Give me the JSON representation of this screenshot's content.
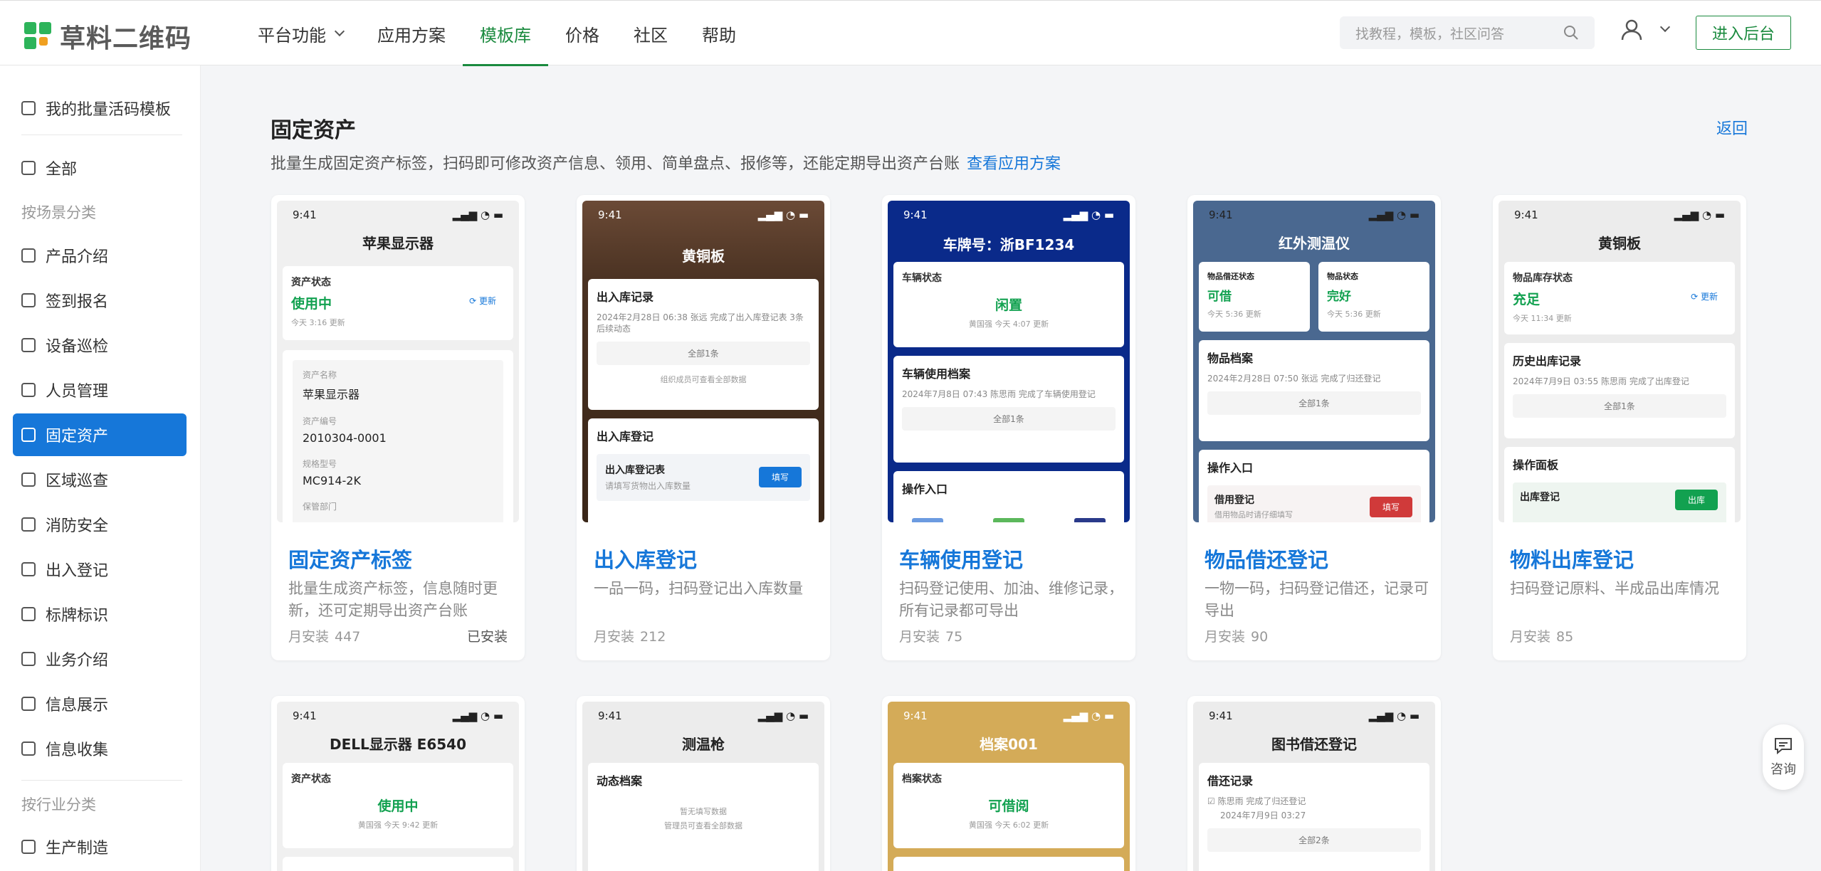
{
  "brand": {
    "name": "草料二维码",
    "colors": [
      "#2db45a",
      "#2db45a",
      "#2db45a",
      "#f0a020"
    ]
  },
  "nav": [
    {
      "label": "平台功能",
      "has_dropdown": true
    },
    {
      "label": "应用方案"
    },
    {
      "label": "模板库",
      "active": true
    },
    {
      "label": "价格"
    },
    {
      "label": "社区"
    },
    {
      "label": "帮助"
    }
  ],
  "search": {
    "placeholder": "找教程，模板，社区问答",
    "icon": "search-icon"
  },
  "user": {
    "icon": "user-icon"
  },
  "admin_button": "进入后台",
  "sidebar": {
    "my_templates": "我的批量活码模板",
    "all": "全部",
    "scene_head": "按场景分类",
    "scene_items": [
      "产品介绍",
      "签到报名",
      "设备巡检",
      "人员管理",
      "固定资产",
      "区域巡查",
      "消防安全",
      "出入登记",
      "标牌标识",
      "业务介绍",
      "信息展示",
      "信息收集"
    ],
    "active_item": "固定资产",
    "industry_head": "按行业分类",
    "industry_items": [
      "生产制造"
    ]
  },
  "page": {
    "title": "固定资产",
    "back": "返回",
    "description": "批量生成固定资产标签，扫码即可修改资产信息、领用、简单盘点、报修等，还能定期导出资产台账",
    "solution_link": "查看应用方案"
  },
  "cards": [
    {
      "name": "固定资产标签",
      "desc": "批量生成资产标签，信息随时更新，还可定期导出资产台账",
      "stat_label": "月安装",
      "stat": "447",
      "tag": "已安装",
      "preview": {
        "time": "9:41",
        "title": "苹果显示器",
        "status_label": "资产状态",
        "status": "使用中",
        "update": "更新",
        "status_time": "今天 3:16 更新",
        "fields": [
          {
            "label": "资产名称",
            "value": "苹果显示器"
          },
          {
            "label": "资产编号",
            "value": "2010304-0001"
          },
          {
            "label": "规格型号",
            "value": "MC914-2K"
          },
          {
            "label": "保管部门",
            "value": ""
          }
        ]
      }
    },
    {
      "name": "出入库登记",
      "desc": "一品一码，扫码登记出入库数量",
      "stat_label": "月安装",
      "stat": "212",
      "preview": {
        "time": "9:41",
        "title": "黄铜板",
        "rec_title": "出入库记录",
        "rec_line": "2024年2月28日 06:38 张远 完成了出入库登记表 3条后续动态",
        "rec_btn": "全部1条",
        "rec_note": "组织成员可查看全部数据",
        "form_section": "出入库登记",
        "form_title": "出入库登记表",
        "form_sub": "请填写货物出入库数量",
        "form_btn": "填写"
      }
    },
    {
      "name": "车辆使用登记",
      "desc": "扫码登记使用、加油、维修记录，所有记录都可导出",
      "stat_label": "月安装",
      "stat": "75",
      "preview": {
        "time": "9:41",
        "title": "车牌号：浙BF1234",
        "status_label": "车辆状态",
        "status": "闲置",
        "status_time": "黄国强 今天 4:07 更新",
        "rec_title": "车辆使用档案",
        "rec_line": "2024年7月8日 07:43 陈思雨 完成了车辆使用登记",
        "rec_btn": "全部1条",
        "op_title": "操作入口"
      }
    },
    {
      "name": "物品借还登记",
      "desc": "一物一码，扫码登记借还，记录可导出",
      "stat_label": "月安装",
      "stat": "90",
      "preview": {
        "time": "9:41",
        "title": "红外测温仪",
        "s1_label": "物品借还状态",
        "s1": "可借",
        "s1_time": "今天 5:36 更新",
        "s2_label": "物品状态",
        "s2": "完好",
        "s2_time": "今天 5:36 更新",
        "rec_title": "物品档案",
        "rec_line": "2024年2月28日 07:50 张远 完成了归还登记",
        "rec_btn": "全部1条",
        "op_title": "操作入口",
        "op_item": "借用登记",
        "op_sub": "借用物品时请仔细填写",
        "op_btn": "填写"
      }
    },
    {
      "name": "物料出库登记",
      "desc": "扫码登记原料、半成品出库情况",
      "stat_label": "月安装",
      "stat": "85",
      "preview": {
        "time": "9:41",
        "title": "黄铜板",
        "status_label": "物品库存状态",
        "status": "充足",
        "update": "更新",
        "status_time": "今天 11:34 更新",
        "rec_title": "历史出库记录",
        "rec_line": "2024年7月9日 03:55 陈思雨 完成了出库登记",
        "rec_btn": "全部1条",
        "op_title": "操作面板",
        "op_item": "出库登记",
        "op_btn": "出库"
      }
    },
    {
      "preview": {
        "time": "9:41",
        "title": "DELL显示器 E6540",
        "status_label": "资产状态",
        "status": "使用中",
        "status_time": "黄国强 今天 9:42 更新"
      }
    },
    {
      "preview": {
        "time": "9:41",
        "title": "测温枪",
        "rec_title": "动态档案",
        "empty": "暂无填写数据",
        "note": "管理员可查看全部数据"
      }
    },
    {
      "preview": {
        "time": "9:41",
        "title": "档案001",
        "status_label": "档案状态",
        "status": "可借阅",
        "status_time": "黄国强 今天 6:02 更新"
      }
    },
    {
      "preview": {
        "time": "9:41",
        "title": "图书借还登记",
        "rec_title": "借还记录",
        "rec_line": "陈思雨 完成了归还登记",
        "rec_time": "2024年7月9日 03:27",
        "rec_btn": "全部2条"
      }
    }
  ],
  "float_button": {
    "label": "咨询",
    "icon": "chat-icon"
  }
}
